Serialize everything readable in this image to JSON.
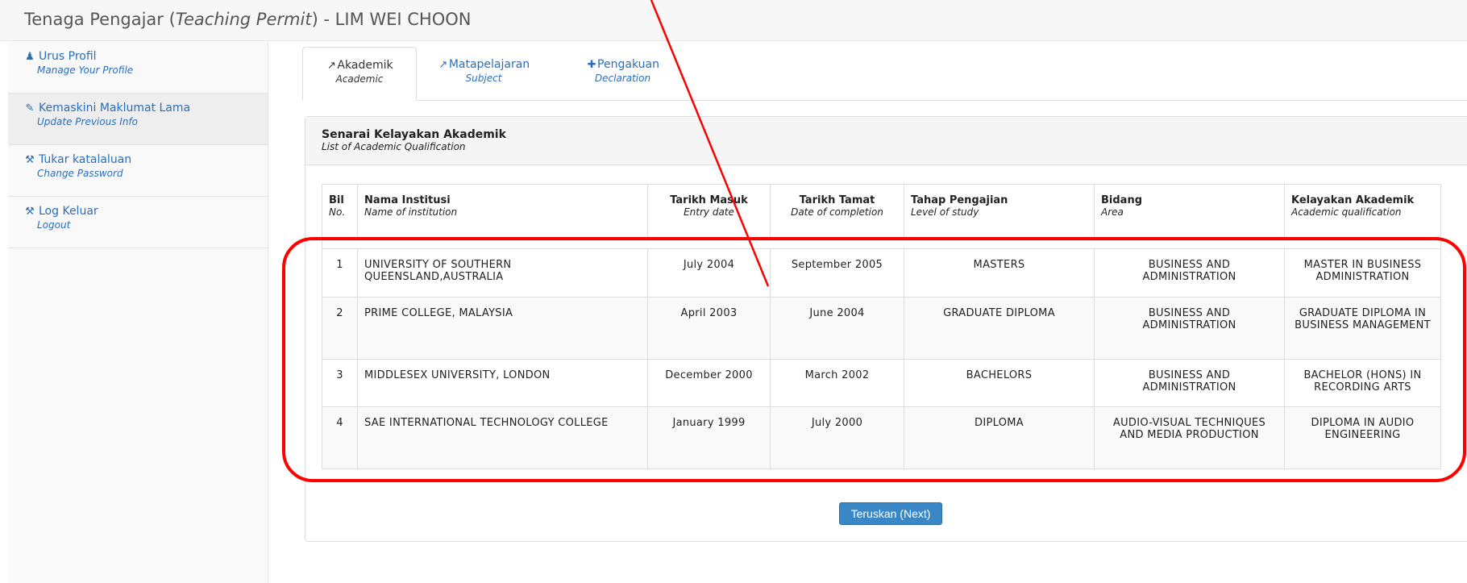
{
  "page": {
    "title_prefix": "Tenaga Pengajar (",
    "title_italic": "Teaching Permit",
    "title_suffix": ") - LIM WEI CHOON"
  },
  "sidebar": {
    "items": [
      {
        "icon": "user-icon",
        "glyph": "👤",
        "label": "Urus Profil",
        "sub": "Manage Your Profile",
        "active": false
      },
      {
        "icon": "edit-icon",
        "glyph": "✎",
        "label": "Kemaskini Maklumat Lama",
        "sub": "Update Previous Info",
        "active": true
      },
      {
        "icon": "wrench-icon",
        "glyph": "🔧",
        "label": "Tukar katalaluan",
        "sub": "Change Password",
        "active": false
      },
      {
        "icon": "wrench-icon",
        "glyph": "🔧",
        "label": "Log Keluar",
        "sub": "Logout",
        "active": false
      }
    ]
  },
  "tabs": [
    {
      "icon": "external-link-icon",
      "glyph": "↗",
      "label": "Akademik",
      "sub": "Academic",
      "active": true
    },
    {
      "icon": "external-link-icon",
      "glyph": "↗",
      "label": "Matapelajaran",
      "sub": "Subject",
      "active": false
    },
    {
      "icon": "plus-icon",
      "glyph": "✚",
      "label": "Pengakuan",
      "sub": "Declaration",
      "active": false
    }
  ],
  "panel": {
    "title": "Senarai Kelayakan Akademik",
    "subtitle": "List of Academic Qualification"
  },
  "table": {
    "headers": [
      {
        "label": "Bil",
        "sub": "No."
      },
      {
        "label": "Nama Institusi",
        "sub": "Name of institution"
      },
      {
        "label": "Tarikh Masuk",
        "sub": "Entry date"
      },
      {
        "label": "Tarikh Tamat",
        "sub": "Date of completion"
      },
      {
        "label": "Tahap Pengajian",
        "sub": "Level of study"
      },
      {
        "label": "Bidang",
        "sub": "Area"
      },
      {
        "label": "Kelayakan Akademik",
        "sub": "Academic qualification"
      }
    ],
    "rows": [
      [
        "1",
        "UNIVERSITY OF SOUTHERN QUEENSLAND,AUSTRALIA",
        "July 2004",
        "September 2005",
        "MASTERS",
        "BUSINESS AND ADMINISTRATION",
        "MASTER IN BUSINESS ADMINISTRATION"
      ],
      [
        "2",
        "PRIME COLLEGE, MALAYSIA",
        "April 2003",
        "June 2004",
        "GRADUATE DIPLOMA",
        "BUSINESS AND ADMINISTRATION",
        "GRADUATE DIPLOMA IN BUSINESS MANAGEMENT"
      ],
      [
        "3",
        "MIDDLESEX UNIVERSITY, LONDON",
        "December 2000",
        "March 2002",
        "BACHELORS",
        "BUSINESS AND ADMINISTRATION",
        "BACHELOR (HONS) IN RECORDING ARTS"
      ],
      [
        "4",
        "SAE INTERNATIONAL TECHNOLOGY COLLEGE",
        "January 1999",
        "July 2000",
        "DIPLOMA",
        "AUDIO-VISUAL TECHNIQUES AND MEDIA PRODUCTION",
        "DIPLOMA IN AUDIO ENGINEERING"
      ]
    ]
  },
  "buttons": {
    "next": "Teruskan (Next)"
  },
  "colors": {
    "link": "#2a6ebb",
    "annotation": "#ff0000",
    "button": "#3a87c8"
  }
}
